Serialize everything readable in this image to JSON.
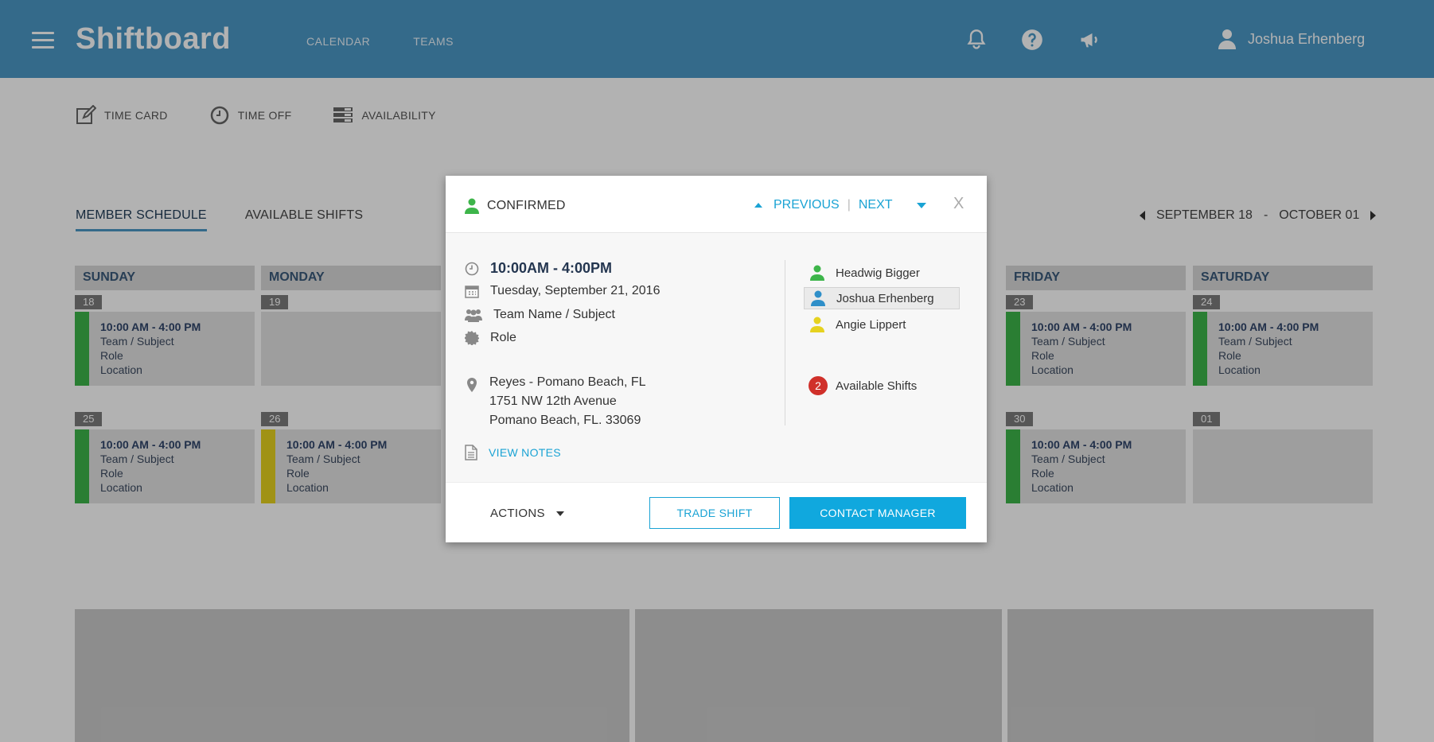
{
  "app": {
    "brand": "Shiftboard"
  },
  "nav": {
    "items": [
      {
        "label": "CALENDAR"
      },
      {
        "label": "TEAMS"
      }
    ]
  },
  "header": {
    "user_name": "Joshua Erhenberg"
  },
  "subbar": {
    "items": [
      {
        "label": "TIME CARD",
        "icon": "edit-icon"
      },
      {
        "label": "TIME OFF",
        "icon": "clock-icon"
      },
      {
        "label": "AVAILABILITY",
        "icon": "list-icon"
      }
    ]
  },
  "tabs": [
    {
      "label": "MEMBER SCHEDULE"
    },
    {
      "label": "AVAILABLE SHIFTS"
    }
  ],
  "daterange": {
    "start": "SEPTEMBER  18",
    "sep": "-",
    "end": "OCTOBER 01"
  },
  "calendar": {
    "days": [
      "SUNDAY",
      "MONDAY",
      "FRIDAY",
      "SATURDAY"
    ],
    "dates": [
      "18",
      "19",
      "23",
      "24",
      "25",
      "26",
      "30",
      "01"
    ],
    "shift": {
      "time": "10:00 AM - 4:00 PM",
      "team": "Team / Subject",
      "role": "Role",
      "location": "Location"
    }
  },
  "modal": {
    "status": "CONFIRMED",
    "prev": "PREVIOUS",
    "sep": "|",
    "next": "NEXT",
    "close": "X",
    "time": "10:00AM - 4:00PM",
    "date": "Tuesday, September 21, 2016",
    "team": "Team Name / Subject",
    "role": "Role",
    "address": [
      "Reyes - Pomano Beach, FL",
      "1751 NW 12th  Avenue",
      "Pomano Beach, FL. 33069"
    ],
    "view_notes": "VIEW NOTES",
    "people": [
      {
        "name": "Headwig Bigger",
        "color": "#3db54a"
      },
      {
        "name": "Joshua Erhenberg",
        "color": "#2f8fc9"
      },
      {
        "name": "Angie Lippert",
        "color": "#e6d21f"
      }
    ],
    "available_count": "2",
    "available_label": "Available Shifts",
    "actions": "ACTIONS",
    "trade": "TRADE SHIFT",
    "contact": "CONTACT MANAGER"
  },
  "colors": {
    "header": "#4b98c6",
    "accent": "#1aa3d4",
    "green": "#3db54a",
    "yellow": "#e6d21f",
    "badge": "#d0302a"
  }
}
